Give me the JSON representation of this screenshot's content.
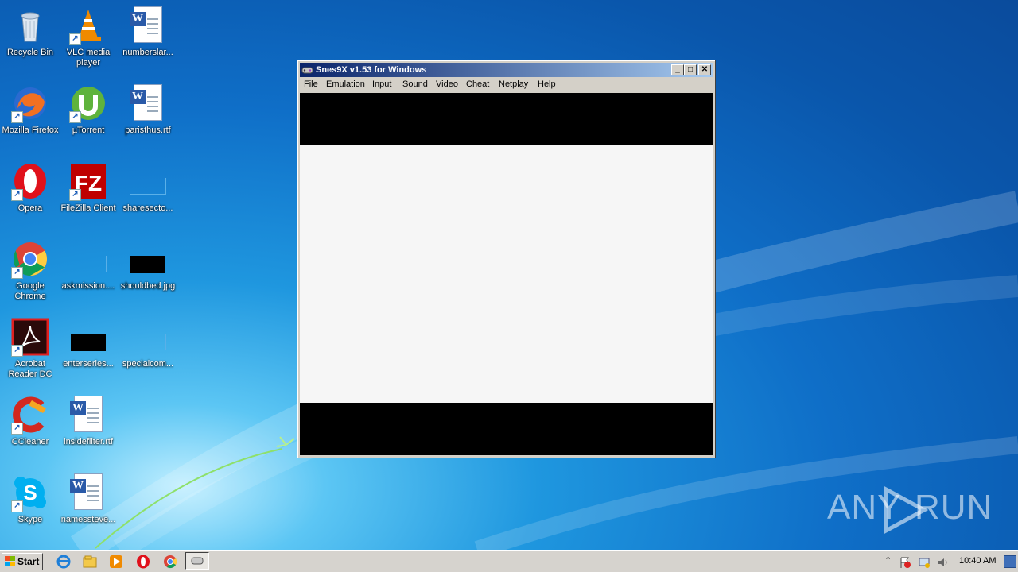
{
  "desktop_icons": [
    {
      "label": "Recycle Bin"
    },
    {
      "label": "VLC media player"
    },
    {
      "label": "numberslar..."
    },
    {
      "label": "Mozilla Firefox"
    },
    {
      "label": "µTorrent"
    },
    {
      "label": "paristhus.rtf"
    },
    {
      "label": "Opera"
    },
    {
      "label": "FileZilla Client"
    },
    {
      "label": "sharesecto..."
    },
    {
      "label": "Google Chrome"
    },
    {
      "label": "askmission...."
    },
    {
      "label": "shouldbed.jpg"
    },
    {
      "label": "Acrobat Reader DC"
    },
    {
      "label": "enterseries..."
    },
    {
      "label": "specialcom..."
    },
    {
      "label": "CCleaner"
    },
    {
      "label": "insidefilter.rtf"
    },
    {
      "label": "Skype"
    },
    {
      "label": "namessteve..."
    }
  ],
  "window": {
    "title": "Snes9X v1.53 for Windows",
    "controls": {
      "minimize": "_",
      "maximize": "□",
      "close": "✕"
    },
    "menu": [
      "File",
      "Emulation",
      "Input",
      "Sound",
      "Video",
      "Cheat",
      "Netplay",
      "Help"
    ]
  },
  "taskbar": {
    "start_label": "Start",
    "clock": "10:40 AM"
  },
  "watermark": {
    "text_left": "ANY",
    "text_right": "RUN"
  },
  "colors": {
    "titlebar_start": "#0a246a",
    "titlebar_end": "#a6caf0",
    "taskbar": "#d6d3ce"
  }
}
